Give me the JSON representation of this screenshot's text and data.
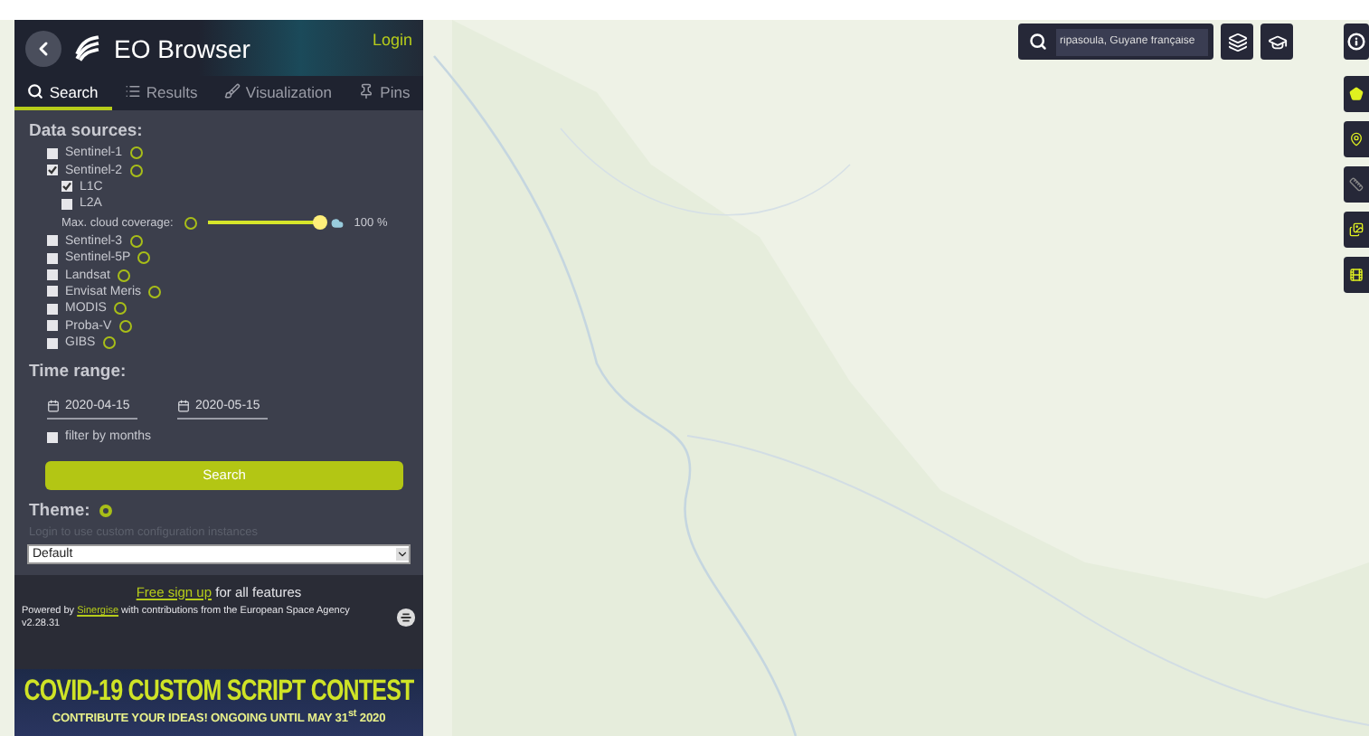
{
  "header": {
    "title": "EO Browser",
    "login": "Login"
  },
  "tabs": [
    {
      "label": "Search",
      "selected": true,
      "kind": "search"
    },
    {
      "label": "Results",
      "selected": false,
      "kind": "results"
    },
    {
      "label": "Visualization",
      "selected": false,
      "kind": "visualization"
    },
    {
      "label": "Pins",
      "selected": false,
      "kind": "pins"
    }
  ],
  "data_sources": {
    "title": "Data sources:",
    "items": [
      {
        "name": "Sentinel-1",
        "checked": false
      },
      {
        "name": "Sentinel-2",
        "checked": true,
        "children": [
          {
            "name": "L1C",
            "checked": true
          },
          {
            "name": "L2A",
            "checked": false
          }
        ],
        "cloud_coverage": {
          "label": "Max. cloud coverage:",
          "level": 1,
          "reading": "100 %"
        }
      },
      {
        "name": "Sentinel-3",
        "checked": false
      },
      {
        "name": "Sentinel-5P",
        "checked": false
      },
      {
        "name": "Landsat",
        "checked": false
      },
      {
        "name": "Envisat Meris",
        "checked": false
      },
      {
        "name": "MODIS",
        "checked": false
      },
      {
        "name": "Proba-V",
        "checked": false
      },
      {
        "name": "GIBS",
        "checked": false
      }
    ]
  },
  "time_range": {
    "title": "Time range:",
    "from": "2020-04-15",
    "to": "2020-05-15",
    "filter_by_months": {
      "label": "filter by months",
      "checked": false
    }
  },
  "search_button": "Search",
  "theme": {
    "title": "Theme:",
    "hint": "Login to use custom configuration instances",
    "value": "Default"
  },
  "footer": {
    "signup_link": "Free sign up",
    "signup_rest": "for all features",
    "powered_by": "Powered by",
    "company_link": "Sinergise",
    "credits": "with contributions from the European Space Agency",
    "version": "v2.28.31"
  },
  "banner": {
    "title": "COVID-19 CUSTOM SCRIPT CONTEST",
    "subtitle": "CONTRIBUTE YOUR IDEAS! ONGOING UNTIL MAY 31$^{st}$ 2020"
  },
  "map_search": {
    "value": "ripasoula, Guyane française"
  }
}
